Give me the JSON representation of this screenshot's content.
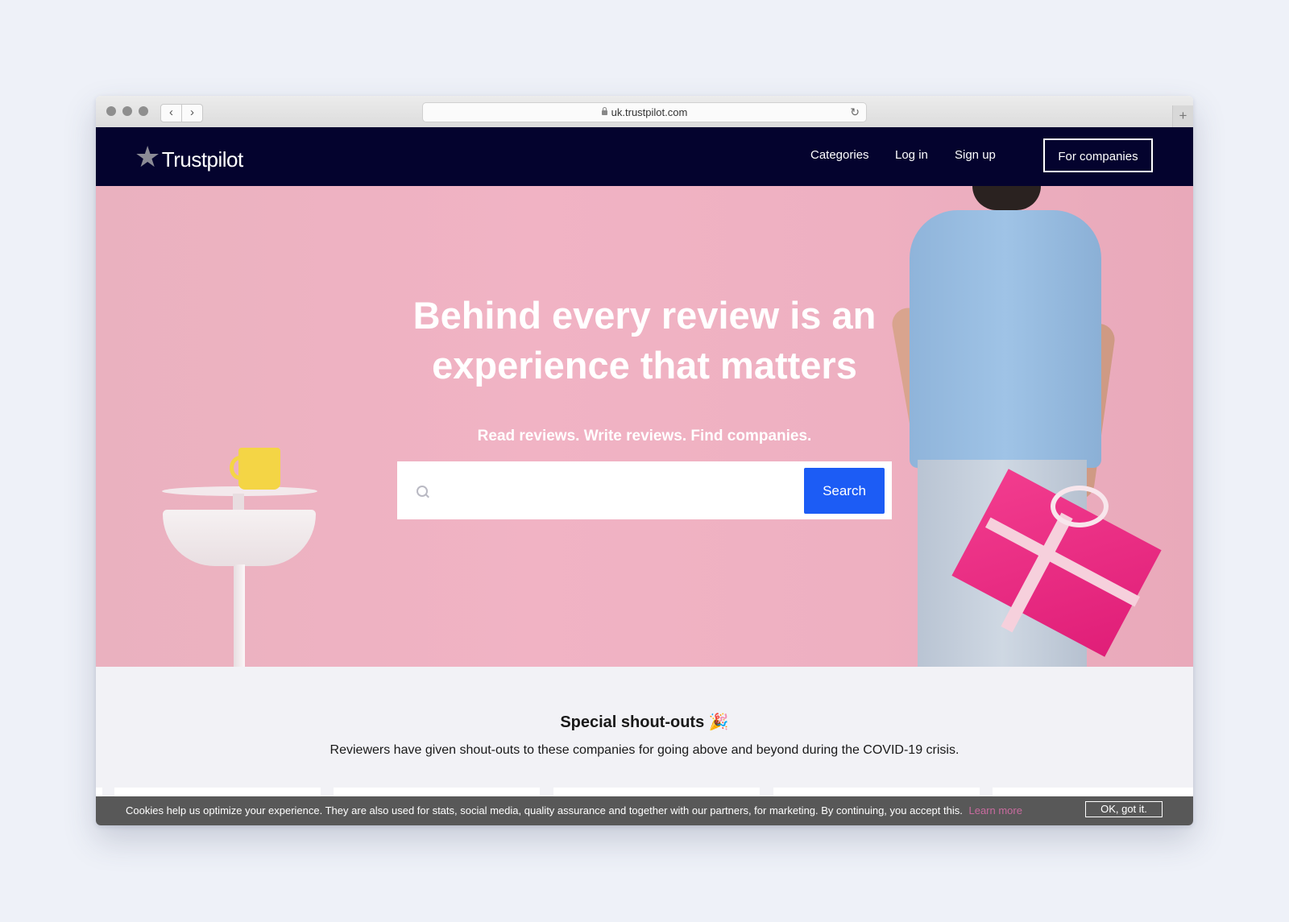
{
  "browser": {
    "url": "uk.trustpilot.com",
    "back_glyph": "‹",
    "forward_glyph": "›",
    "reload_glyph": "↻",
    "newtab_glyph": "+"
  },
  "nav": {
    "logo_star": "★",
    "logo_text": "Trustpilot",
    "links": [
      "Categories",
      "Log in",
      "Sign up"
    ],
    "cta": "For companies",
    "bg_color": "#04032e"
  },
  "hero": {
    "headline_line1": "Behind every review is an",
    "headline_line2": "experience that matters",
    "subheadline": "Read reviews. Write reviews. Find companies.",
    "search_placeholder": "",
    "search_button": "Search",
    "accent_color": "#1c5cf5"
  },
  "shoutouts": {
    "title": "Special shout-outs 🎉",
    "description": "Reviewers have given shout-outs to these companies for going above and beyond during the COVID-19 crisis."
  },
  "cookie_banner": {
    "text": "Cookies help us optimize your experience. They are also used for stats, social media, quality assurance and together with our partners, for marketing. By continuing, you accept this.",
    "learn_more": "Learn more",
    "ok_button": "OK, got it."
  }
}
